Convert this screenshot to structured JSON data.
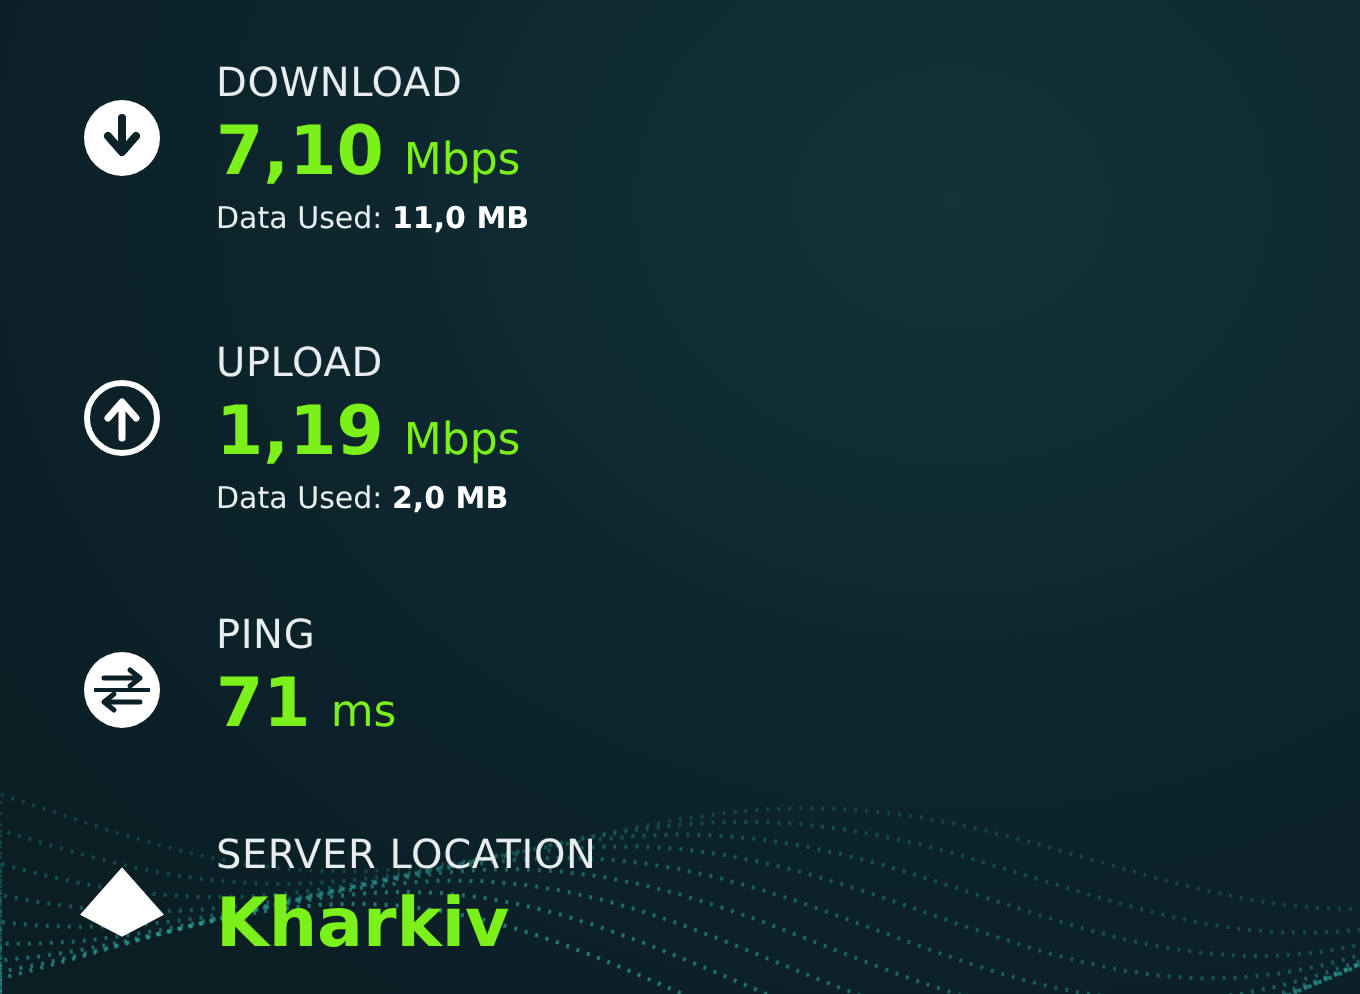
{
  "metrics": [
    {
      "kind": "download",
      "label": "DOWNLOAD",
      "value": "7,10",
      "unit": "Mbps",
      "detail_label": "Data Used:",
      "detail_value": "11,0 MB"
    },
    {
      "kind": "upload",
      "label": "UPLOAD",
      "value": "1,19",
      "unit": "Mbps",
      "detail_label": "Data Used:",
      "detail_value": "2,0 MB"
    },
    {
      "kind": "ping",
      "label": "PING",
      "value": "71",
      "unit": "ms"
    },
    {
      "kind": "location",
      "label": "SERVER LOCATION",
      "value": "Kharkiv"
    }
  ]
}
